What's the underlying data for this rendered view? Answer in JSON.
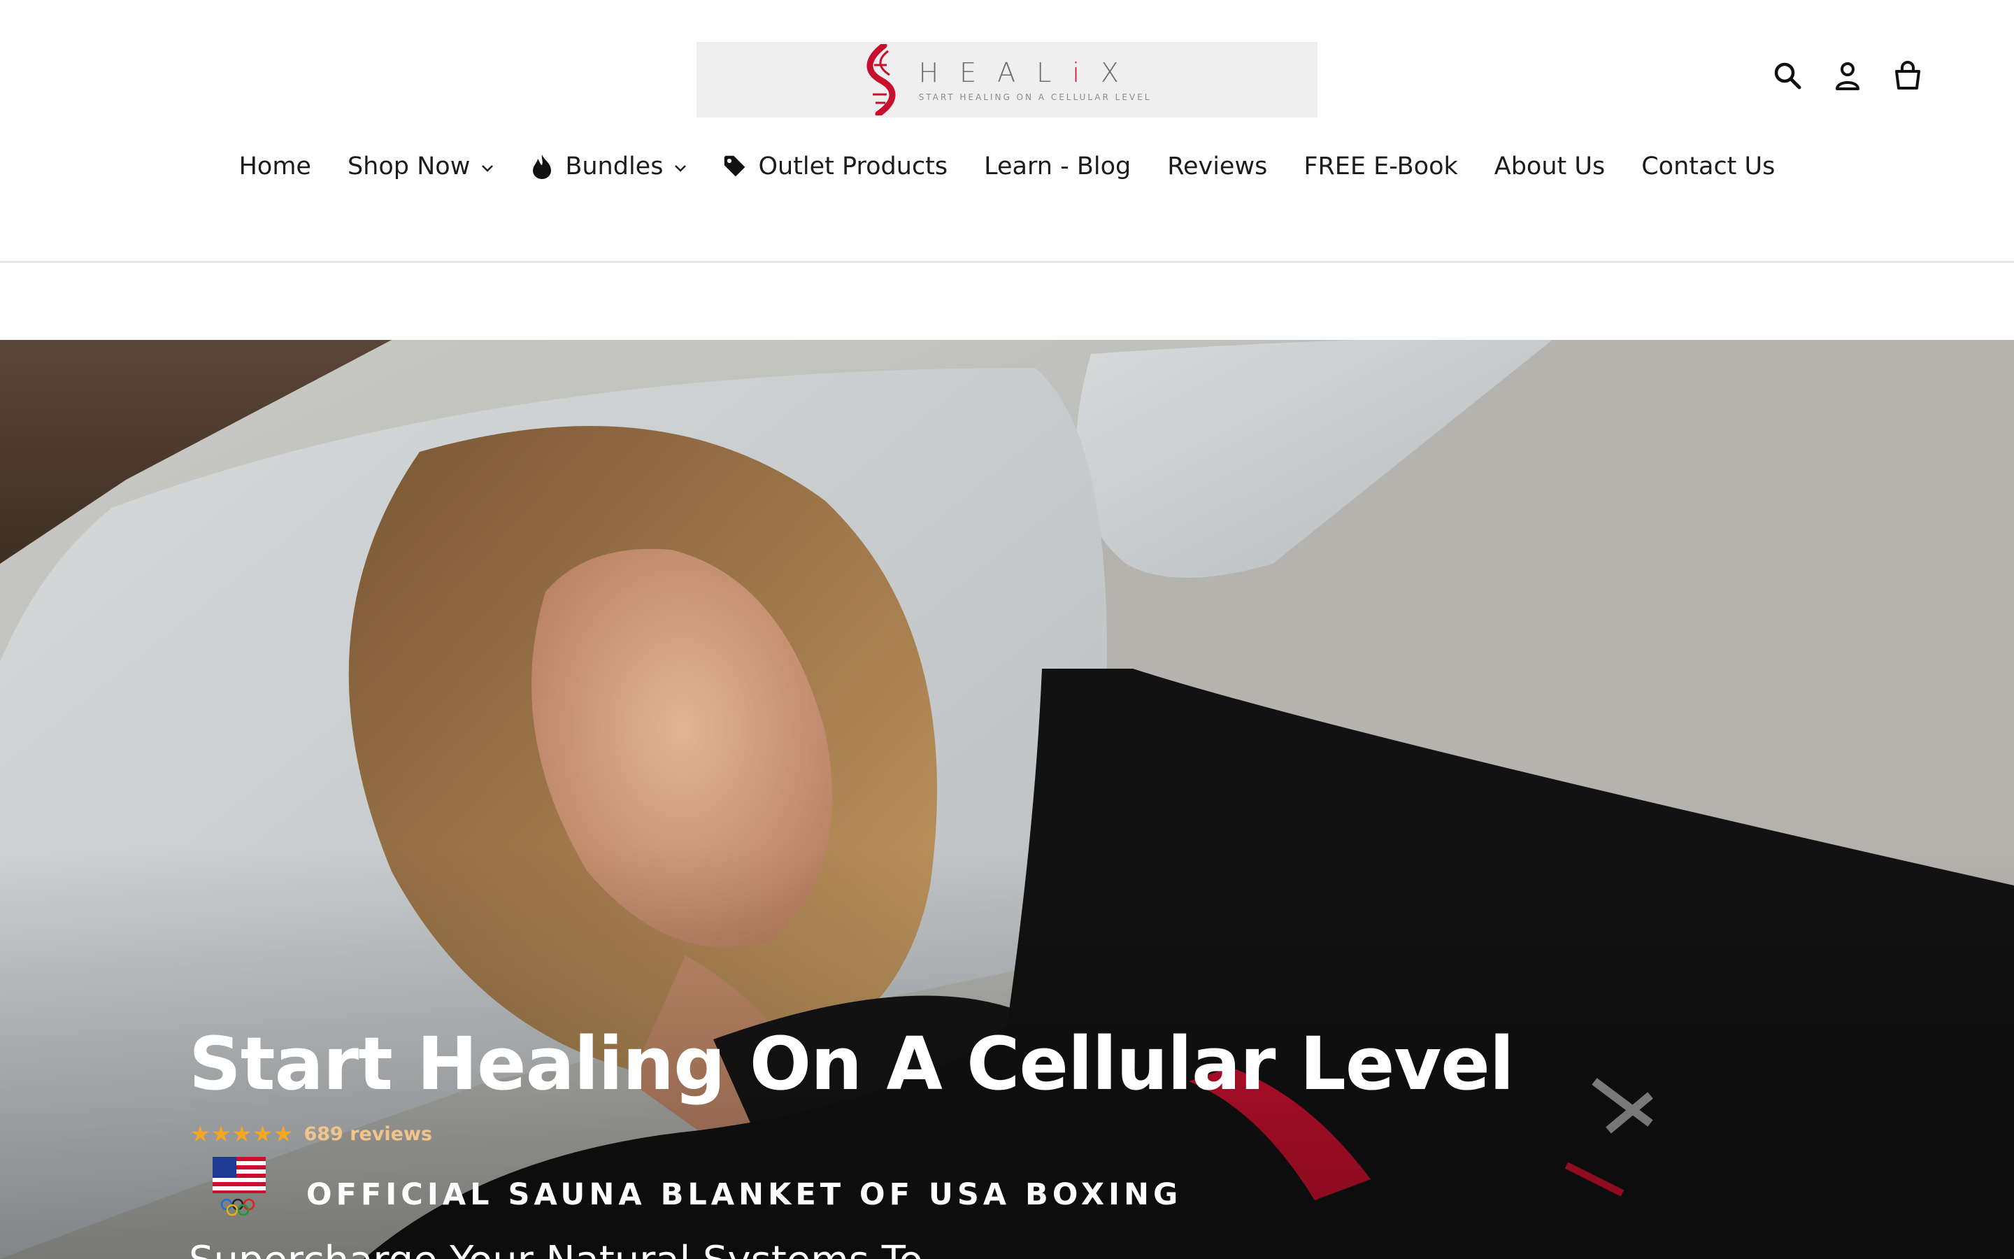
{
  "brand": {
    "logo_word_prefix": "HEAL",
    "logo_word_red": "i",
    "logo_word_suffix": "X",
    "logo_tagline": "START HEALING ON A CELLULAR LEVEL"
  },
  "header_icons": [
    "search-icon",
    "account-icon",
    "cart-icon"
  ],
  "nav": {
    "items": [
      {
        "label": "Home"
      },
      {
        "label": "Shop Now"
      },
      {
        "label": "Bundles"
      },
      {
        "label": "Outlet Products"
      },
      {
        "label": "Learn - Blog"
      },
      {
        "label": "Reviews"
      },
      {
        "label": "FREE E-Book"
      },
      {
        "label": "About Us"
      },
      {
        "label": "Contact Us"
      }
    ]
  },
  "hero": {
    "title": "Start Healing On A Cellular Level",
    "rating_stars": "★★★★★",
    "rating_value": 5,
    "reviews_text": "689 reviews",
    "official_text": "OFFICIAL SAUNA BLANKET OF USA BOXING",
    "subtitle": "Supercharge Your Natural Systems To",
    "blanket_mark": "i X"
  },
  "colors": {
    "accent_red": "#c8102e",
    "star_color": "#f5a623",
    "nav_text": "#1c1c1c"
  }
}
